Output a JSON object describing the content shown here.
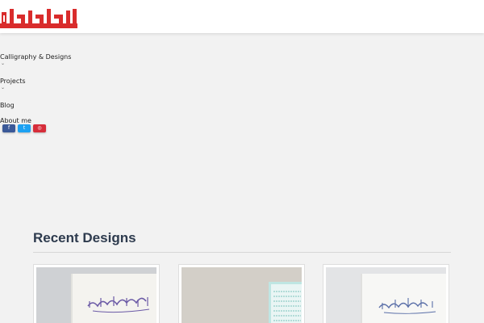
{
  "brand": {
    "logo_icon": "arabic-calligraphy-logo",
    "logo_color": "#d92c2c"
  },
  "nav": {
    "items": [
      {
        "label": "Calligraphy & Designs",
        "has_dropdown": true
      },
      {
        "label": "Projects",
        "has_dropdown": true
      },
      {
        "label": "Blog",
        "has_dropdown": false
      },
      {
        "label": "About me",
        "has_dropdown": false
      }
    ],
    "caret": "⌄"
  },
  "social": [
    {
      "name": "facebook",
      "icon": "facebook-icon",
      "glyph": "f",
      "color": "#3b5998"
    },
    {
      "name": "twitter",
      "icon": "twitter-icon",
      "glyph": "t",
      "color": "#1da1f2"
    },
    {
      "name": "instagram",
      "icon": "instagram-icon",
      "glyph": "◎",
      "color": "#d62d3a"
    }
  ],
  "recent": {
    "title": "Recent Designs",
    "cards": [
      {
        "icon": "calligraphy-artwork-purple",
        "accent": "#6b5aa6"
      },
      {
        "icon": "calligraphy-artwork-teal",
        "accent": "#8fd0cc"
      },
      {
        "icon": "calligraphy-artwork-blue",
        "accent": "#5a6fa8"
      }
    ]
  }
}
